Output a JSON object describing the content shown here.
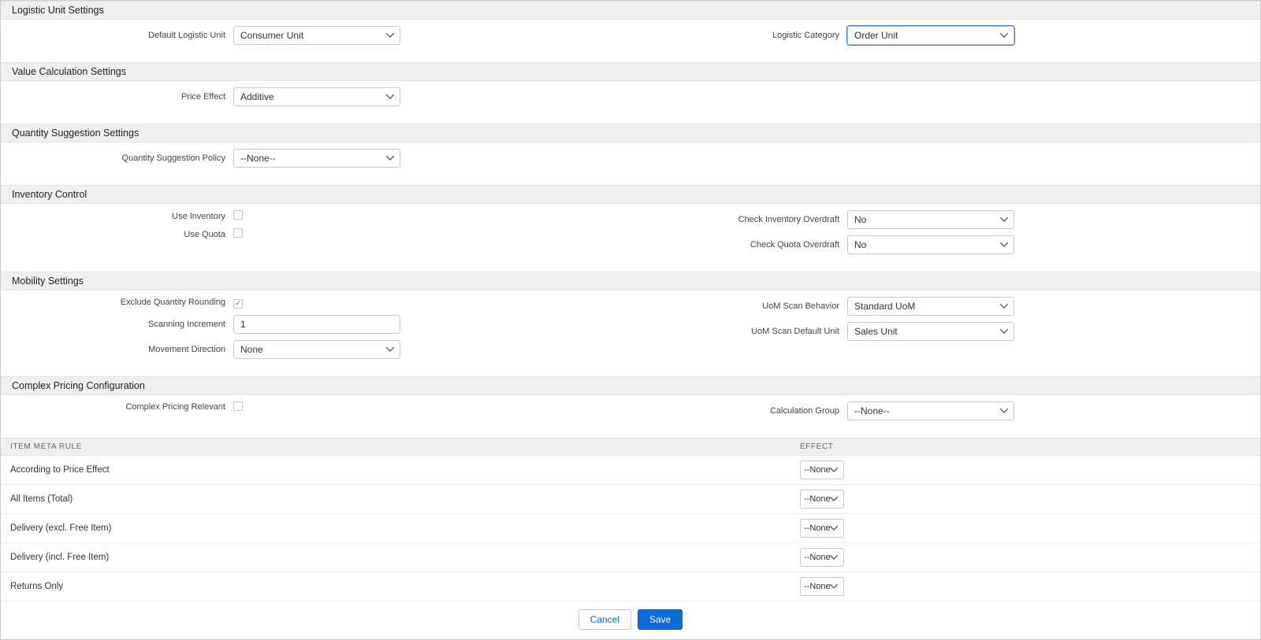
{
  "sections": {
    "logistic": {
      "title": "Logistic Unit Settings",
      "default_unit_label": "Default Logistic Unit",
      "default_unit_value": "Consumer Unit",
      "logistic_category_label": "Logistic Category",
      "logistic_category_value": "Order Unit"
    },
    "value_calc": {
      "title": "Value Calculation Settings",
      "price_effect_label": "Price Effect",
      "price_effect_value": "Additive"
    },
    "quantity": {
      "title": "Quantity Suggestion Settings",
      "policy_label": "Quantity Suggestion Policy",
      "policy_value": "--None--"
    },
    "inventory": {
      "title": "Inventory Control",
      "use_inventory_label": "Use Inventory",
      "use_inventory_checked": false,
      "use_quota_label": "Use Quota",
      "use_quota_checked": false,
      "check_inventory_label": "Check Inventory Overdraft",
      "check_inventory_value": "No",
      "check_quota_label": "Check Quota Overdraft",
      "check_quota_value": "No"
    },
    "mobility": {
      "title": "Mobility Settings",
      "exclude_rounding_label": "Exclude Quantity Rounding",
      "exclude_rounding_checked": true,
      "scanning_increment_label": "Scanning Increment",
      "scanning_increment_value": "1",
      "movement_direction_label": "Movement Direction",
      "movement_direction_value": "None",
      "uom_scan_behavior_label": "UoM Scan Behavior",
      "uom_scan_behavior_value": "Standard UoM",
      "uom_scan_default_label": "UoM Scan Default Unit",
      "uom_scan_default_value": "Sales Unit"
    },
    "complex": {
      "title": "Complex Pricing Configuration",
      "relevant_label": "Complex Pricing Relevant",
      "relevant_checked": false,
      "calc_group_label": "Calculation Group",
      "calc_group_value": "--None--"
    }
  },
  "table": {
    "header_meta": "Item Meta Rule",
    "header_effect": "Effect",
    "rows": [
      {
        "meta": "According to Price Effect",
        "effect": "--None--"
      },
      {
        "meta": "All Items (Total)",
        "effect": "--None--"
      },
      {
        "meta": "Delivery (excl. Free Item)",
        "effect": "--None--"
      },
      {
        "meta": "Delivery (incl. Free Item)",
        "effect": "--None--"
      },
      {
        "meta": "Returns Only",
        "effect": "--None--"
      }
    ]
  },
  "footer": {
    "cancel": "Cancel",
    "save": "Save"
  }
}
